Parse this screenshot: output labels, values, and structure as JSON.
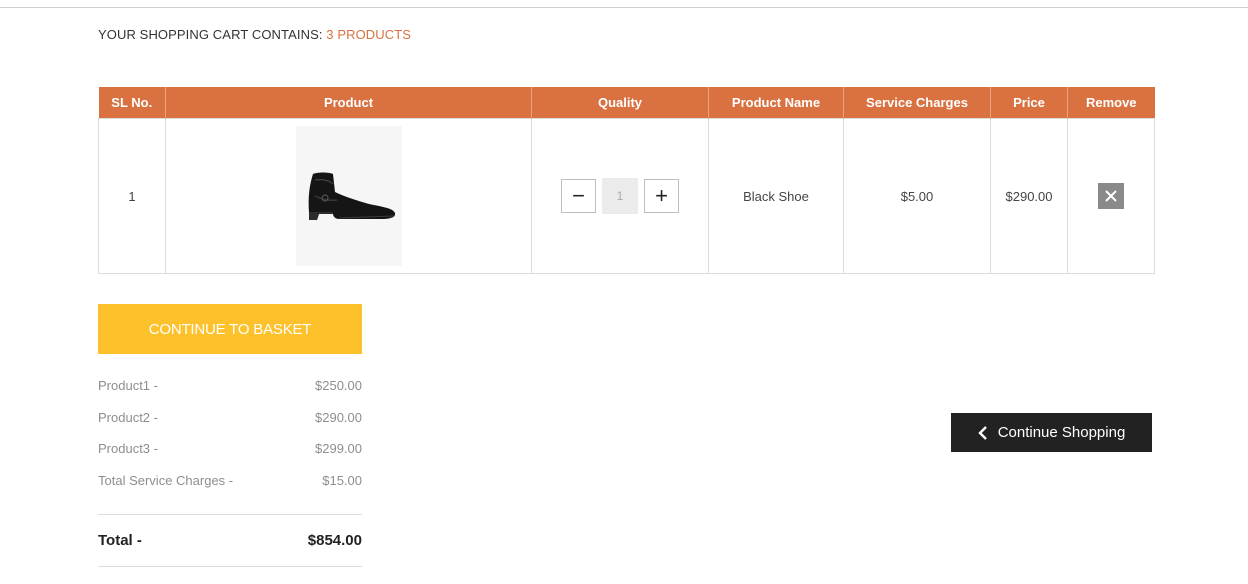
{
  "cart": {
    "heading_prefix": "YOUR SHOPPING CART CONTAINS:",
    "heading_count": "3 PRODUCTS"
  },
  "table": {
    "headers": [
      "SL No.",
      "Product",
      "Quality",
      "Product Name",
      "Service Charges",
      "Price",
      "Remove"
    ],
    "rows": [
      {
        "sl_no": "1",
        "product_image": "black-shoe",
        "quantity": "1",
        "product_name": "Black Shoe",
        "service_charges": "$5.00",
        "price": "$290.00"
      }
    ]
  },
  "buttons": {
    "continue_to_basket": "CONTINUE TO BASKET",
    "continue_shopping": "Continue Shopping",
    "decrement": "−",
    "increment": "+"
  },
  "summary": {
    "items": [
      {
        "label": "Product1 -",
        "value": "$250.00"
      },
      {
        "label": "Product2 -",
        "value": "$290.00"
      },
      {
        "label": "Product3 -",
        "value": "$299.00"
      },
      {
        "label": "Total Service Charges -",
        "value": "$15.00"
      }
    ],
    "total_label": "Total -",
    "total_value": "$854.00"
  },
  "icons": {
    "remove": "close-icon",
    "back": "chevron-left-icon"
  },
  "colors": {
    "accent": "#d97240",
    "basket_button": "#fdc12b",
    "dark_button": "#222222",
    "remove_button": "#8a8a8a"
  }
}
